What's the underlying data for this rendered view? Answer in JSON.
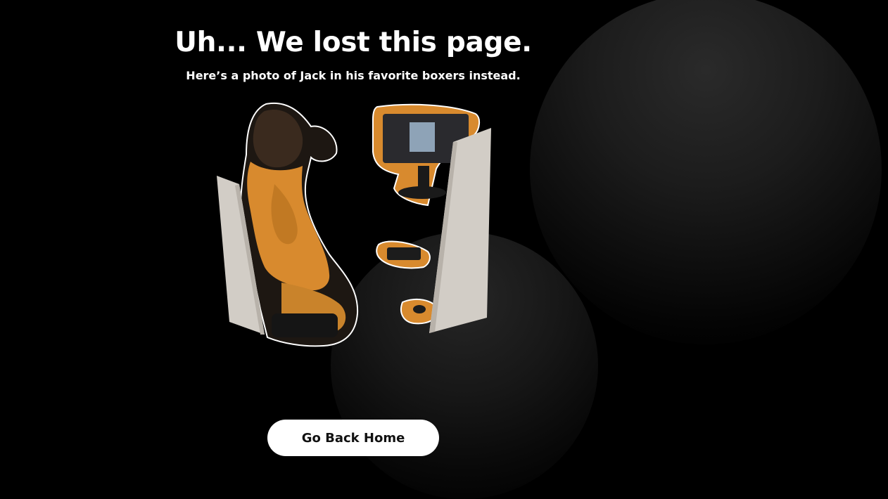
{
  "page": {
    "title": "Uh... We lost this page.",
    "subtitle": "Here’s a photo of Jack in his favorite boxers instead."
  },
  "actions": {
    "home_button_label": "Go Back Home"
  },
  "illustration": {
    "subject": "person-seated-at-desktop-computer-between-cardboard-panels"
  },
  "colors": {
    "background": "#000000",
    "accent_orange": "#d88a2e",
    "button_background": "#ffffff",
    "button_text": "#111111",
    "text": "#ffffff"
  }
}
